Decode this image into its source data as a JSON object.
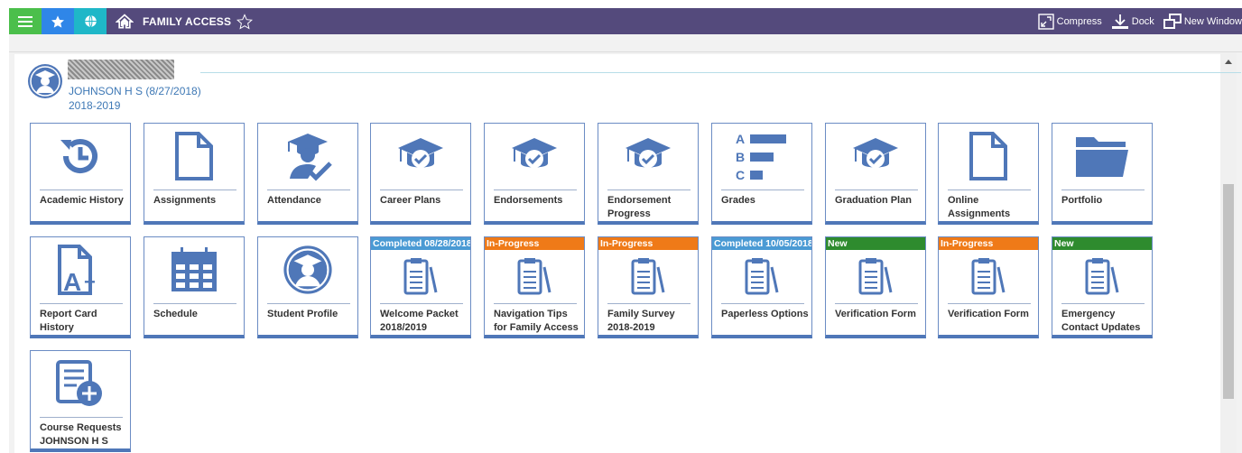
{
  "topbar": {
    "title": "FAMILY ACCESS",
    "actions": {
      "compress": "Compress",
      "dock": "Dock",
      "new_window": "New Window"
    },
    "colors": {
      "bar": "#544a7c",
      "menu": "#4bbf4b",
      "favorites": "#2f86e8",
      "globe": "#1fb7c8"
    },
    "icons": [
      "menu-icon",
      "star-icon",
      "globe-icon",
      "home-icon",
      "star-outline-icon",
      "compress-icon",
      "dock-icon",
      "new-window-icon"
    ]
  },
  "student": {
    "name": "JOHNSON H S (8/27/2018)",
    "year": "2018-2019"
  },
  "tiles_row1": [
    {
      "label": "Academic History",
      "icon": "history-icon"
    },
    {
      "label": "Assignments",
      "icon": "document-icon"
    },
    {
      "label": "Attendance",
      "icon": "graduate-check-icon"
    },
    {
      "label": "Career Plans",
      "icon": "grad-cap-check-icon"
    },
    {
      "label": "Endorsements",
      "icon": "grad-cap-check-icon"
    },
    {
      "label": "Endorsement Progress",
      "icon": "grad-cap-check-icon"
    },
    {
      "label": "Grades",
      "icon": "grades-icon"
    },
    {
      "label": "Graduation Plan",
      "icon": "grad-cap-check-icon"
    },
    {
      "label": "Online Assignments",
      "icon": "document-icon"
    },
    {
      "label": "Portfolio",
      "icon": "folder-icon"
    }
  ],
  "tiles_row2": [
    {
      "label": "Report Card History",
      "icon": "report-card-icon"
    },
    {
      "label": "Schedule",
      "icon": "calendar-icon"
    },
    {
      "label": "Student Profile",
      "icon": "student-avatar-icon"
    },
    {
      "label": "Welcome Packet 2018/2019",
      "icon": "clipboard-icon",
      "badge": "Completed 08/28/2018",
      "badge_color": "#4a9ad4"
    },
    {
      "label": "Navigation Tips for Family Access",
      "icon": "clipboard-icon",
      "badge": "In-Progress",
      "badge_color": "#ef7a18"
    },
    {
      "label": "Family Survey 2018-2019",
      "icon": "clipboard-icon",
      "badge": "In-Progress",
      "badge_color": "#ef7a18"
    },
    {
      "label": "Paperless Options",
      "icon": "clipboard-icon",
      "badge": "Completed 10/05/2018",
      "badge_color": "#4a9ad4"
    },
    {
      "label": "Verification Form",
      "icon": "clipboard-icon",
      "badge": "New",
      "badge_color": "#2e8b2e"
    },
    {
      "label": "Verification Form",
      "icon": "clipboard-icon",
      "badge": "In-Progress",
      "badge_color": "#ef7a18"
    },
    {
      "label": "Emergency Contact Updates",
      "icon": "clipboard-icon",
      "badge": "New",
      "badge_color": "#2e8b2e"
    }
  ],
  "tiles_row3": [
    {
      "label": "Course Requests JOHNSON H S",
      "icon": "course-request-icon"
    }
  ]
}
